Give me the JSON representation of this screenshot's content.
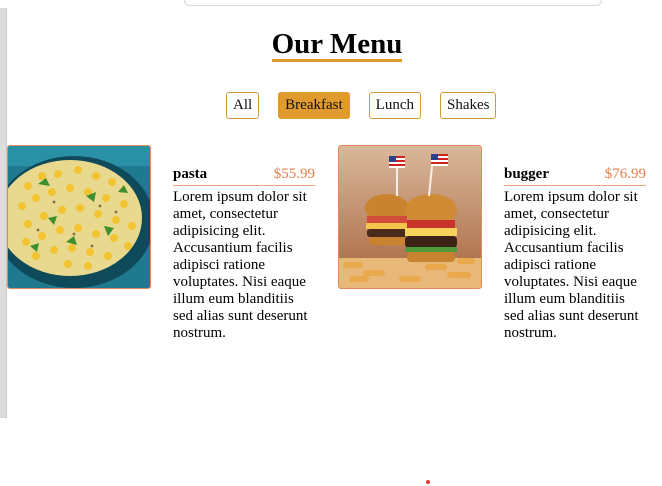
{
  "page": {
    "title": "Our Menu"
  },
  "filters": [
    {
      "label": "All",
      "active": false
    },
    {
      "label": "Breakfast",
      "active": true
    },
    {
      "label": "Lunch",
      "active": false
    },
    {
      "label": "Shakes",
      "active": false
    }
  ],
  "items": [
    {
      "name": "pasta",
      "price": "$55.99",
      "description": "Lorem ipsum dolor sit amet, consectetur adipisicing elit. Accusantium facilis adipisci ratione voluptates. Nisi eaque illum eum blanditiis sed alias sunt deserunt nostrum.",
      "image_icon": "corn-dish-image"
    },
    {
      "name": "bugger",
      "price": "$76.99",
      "description": "Lorem ipsum dolor sit amet, consectetur adipisicing elit. Accusantium facilis adipisci ratione voluptates. Nisi eaque illum eum blanditiis sed alias sunt deserunt nostrum.",
      "image_icon": "burger-image"
    }
  ],
  "colors": {
    "accent": "#e09a2d",
    "price": "#e57e4a",
    "border": "#e58a5b"
  }
}
